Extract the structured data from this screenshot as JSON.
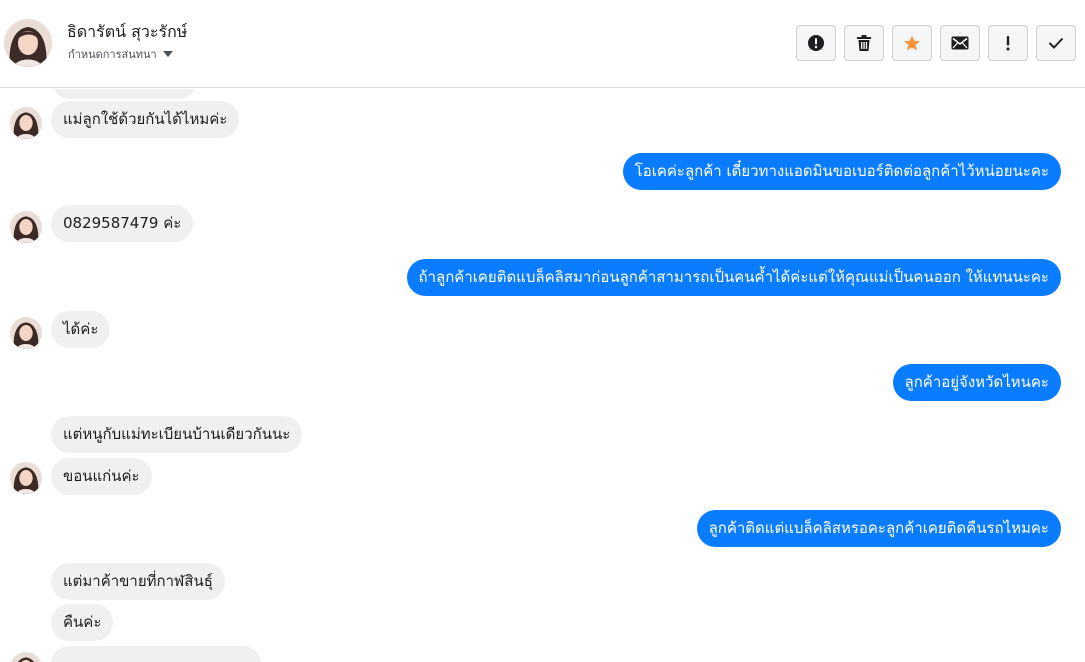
{
  "contact": {
    "name": "ธิดารัตน์ สุวะรักษ์",
    "assign_label": "กำหนดการสนทนา"
  },
  "actions": [
    {
      "name": "mark-spam-button",
      "icon": "alert-circle-icon",
      "color": "#1c1e21"
    },
    {
      "name": "delete-button",
      "icon": "trash-icon",
      "color": "#1c1e21"
    },
    {
      "name": "star-button",
      "icon": "star-icon",
      "color": "#f7923b"
    },
    {
      "name": "mark-unread-button",
      "icon": "envelope-icon",
      "color": "#1c1e21"
    },
    {
      "name": "flag-button",
      "icon": "exclamation-icon",
      "color": "#1c1e21"
    },
    {
      "name": "done-button",
      "icon": "check-icon",
      "color": "#1c1e21"
    }
  ],
  "colors": {
    "outgoing_bubble": "#0a7cff",
    "incoming_bubble": "#f1f0f0"
  },
  "messages": [
    {
      "from": "customer",
      "text": "แม่ลูกใช้ด้วยกันได้ไหมค่ะ"
    },
    {
      "from": "page",
      "text": "โอเคค่ะลูกค้า เดี๋ยวทางแอดมินขอเบอร์ติดต่อลูกค้าไว้หน่อยนะคะ"
    },
    {
      "from": "customer",
      "text": "0829587479 ค่ะ"
    },
    {
      "from": "page",
      "text": "ถ้าลูกค้าเคยติดแบล็คลิสมาก่อนลูกค้าสามารถเป็นคนค้ำได้ค่ะแต่ให้คุณแม่เป็นคนออก ให้แทนนะคะ"
    },
    {
      "from": "customer",
      "text": "ได้ค่ะ"
    },
    {
      "from": "page",
      "text": "ลูกค้าอยู่จังหวัดไหนคะ"
    },
    {
      "from": "customer",
      "text": "แต่หนูกับแม่ทะเบียนบ้านเดียวกันนะ"
    },
    {
      "from": "customer",
      "text": "ขอนแก่นค่ะ"
    },
    {
      "from": "page",
      "text": "ลูกค้าติดแต่แบล็คลิสหรอคะลูกค้าเคยติดคืนรถไหมคะ"
    },
    {
      "from": "customer",
      "text": "แต่มาค้าขายที่กาฬสินธุ์"
    },
    {
      "from": "customer",
      "text": "คืนค่ะ"
    }
  ]
}
